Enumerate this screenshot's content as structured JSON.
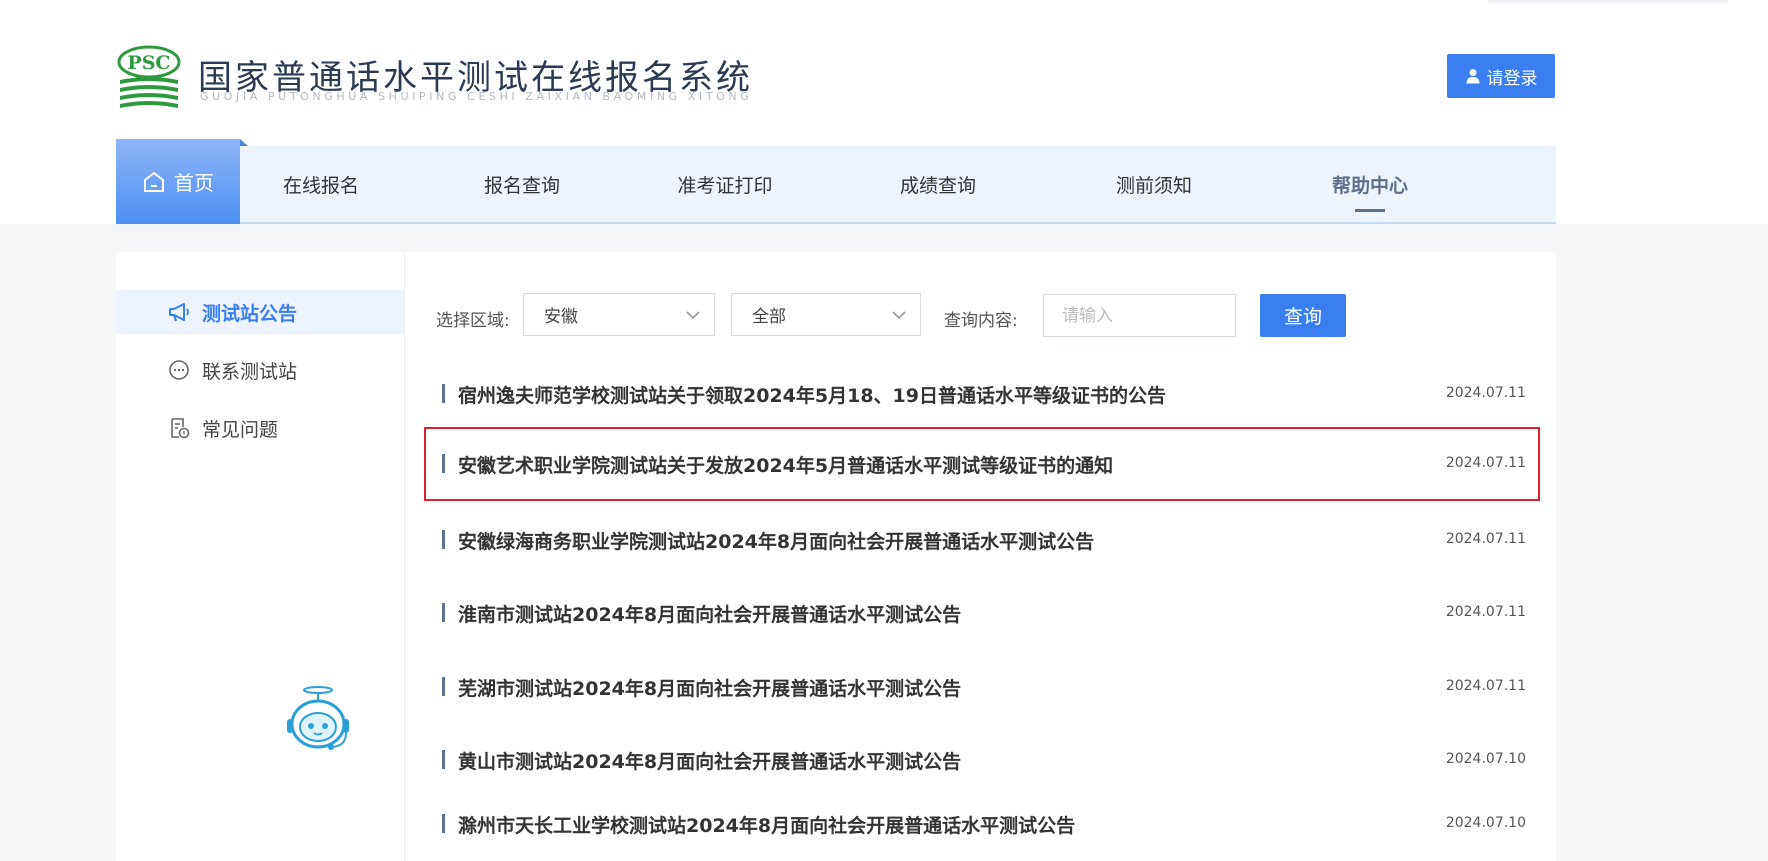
{
  "header": {
    "logo_text": "PSC",
    "title": "国家普通话水平测试在线报名系统",
    "subtitle": "GUOJIA PUTONGHUA SHUIPING CESHI ZAIXIAN BAOMING XITONG",
    "login_label": "请登录"
  },
  "nav": {
    "home": "首页",
    "items": [
      "在线报名",
      "报名查询",
      "准考证打印",
      "成绩查询",
      "测前须知",
      "帮助中心"
    ]
  },
  "sidebar": {
    "items": [
      "测试站公告",
      "联系测试站",
      "常见问题"
    ]
  },
  "filters": {
    "region_label": "选择区域:",
    "region_value": "安徽",
    "category_value": "全部",
    "query_label": "查询内容:",
    "query_placeholder": "请输入",
    "query_button": "查询"
  },
  "notices": [
    {
      "title": "宿州逸夫师范学校测试站关于领取2024年5月18、19日普通话水平等级证书的公告",
      "date": "2024.07.11"
    },
    {
      "title": "安徽艺术职业学院测试站关于发放2024年5月普通话水平测试等级证书的通知",
      "date": "2024.07.11"
    },
    {
      "title": "安徽绿海商务职业学院测试站2024年8月面向社会开展普通话水平测试公告",
      "date": "2024.07.11"
    },
    {
      "title": "淮南市测试站2024年8月面向社会开展普通话水平测试公告",
      "date": "2024.07.11"
    },
    {
      "title": "芜湖市测试站2024年8月面向社会开展普通话水平测试公告",
      "date": "2024.07.11"
    },
    {
      "title": "黄山市测试站2024年8月面向社会开展普通话水平测试公告",
      "date": "2024.07.10"
    },
    {
      "title": "滁州市天长工业学校测试站2024年8月面向社会开展普通话水平测试公告",
      "date": "2024.07.10"
    }
  ],
  "colors": {
    "accent": "#3a7ff0",
    "nav_bg": "#edf4fe",
    "highlight_border": "#d9232a",
    "logo_green": "#2e9a3e"
  }
}
